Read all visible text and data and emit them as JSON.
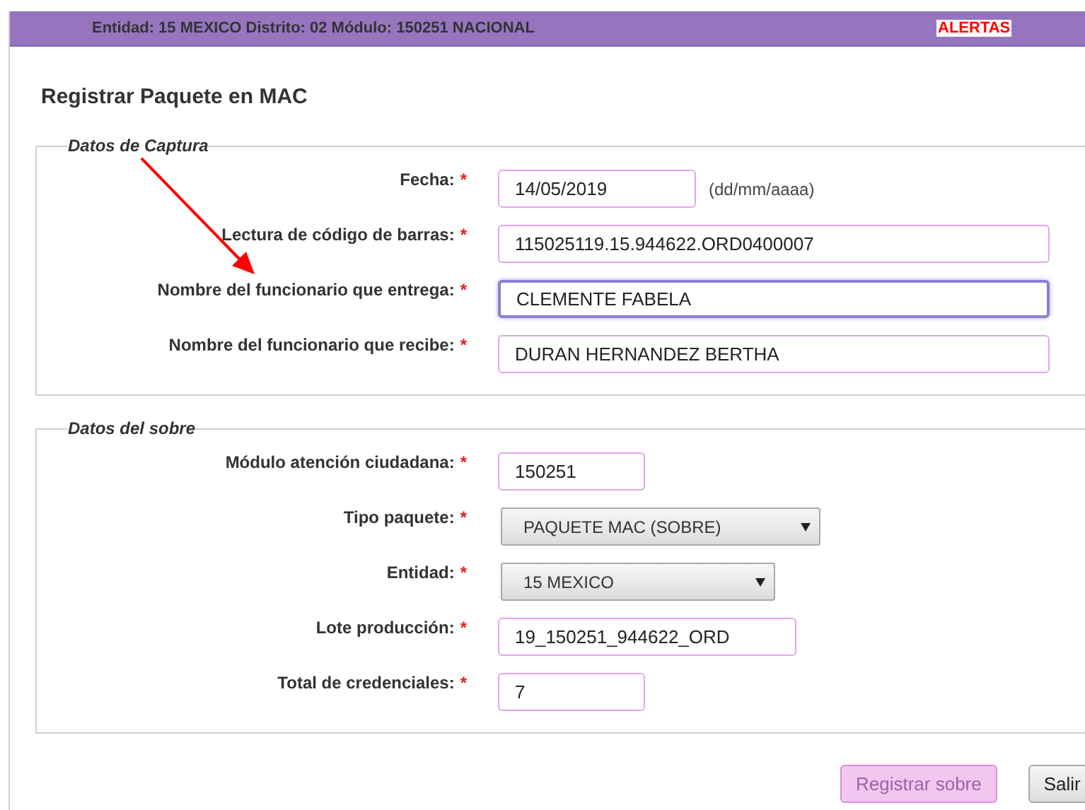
{
  "header": {
    "location": "Entidad: 15 MEXICO Distrito: 02 Módulo: 150251 NACIONAL",
    "alerts": "ALERTAS"
  },
  "title": "Registrar Paquete en MAC",
  "sections": [
    {
      "legend": "Datos de Captura",
      "fields": [
        {
          "kind": "input",
          "label": "Fecha:",
          "value": "14/05/2019",
          "hint": "(dd/mm/aaaa)",
          "focused": false
        },
        {
          "kind": "input",
          "label": "Lectura de código de barras:",
          "value": "115025119.15.944622.ORD0400007",
          "focused": false
        },
        {
          "kind": "input",
          "label": "Nombre del funcionario que entrega:",
          "value": "CLEMENTE FABELA",
          "focused": true
        },
        {
          "kind": "input",
          "label": "Nombre del funcionario que recibe:",
          "value": "DURAN HERNANDEZ BERTHA",
          "focused": false
        }
      ]
    },
    {
      "legend": "Datos del sobre",
      "fields": [
        {
          "kind": "input",
          "label": "Módulo atención ciudadana:",
          "value": "150251",
          "focused": false
        },
        {
          "kind": "select",
          "label": "Tipo paquete:",
          "value": "PAQUETE MAC (SOBRE)"
        },
        {
          "kind": "select",
          "label": "Entidad:",
          "value": "15 MEXICO"
        },
        {
          "kind": "input",
          "label": "Lote producción:",
          "value": "19_150251_944622_ORD",
          "focused": false
        },
        {
          "kind": "input",
          "label": "Total de credenciales:",
          "value": "7",
          "focused": false
        }
      ]
    }
  ],
  "required_mark": "*",
  "buttons": [
    {
      "label": "Registrar sobre",
      "kind": "primary"
    },
    {
      "label": "Salir",
      "kind": "secondary"
    }
  ]
}
